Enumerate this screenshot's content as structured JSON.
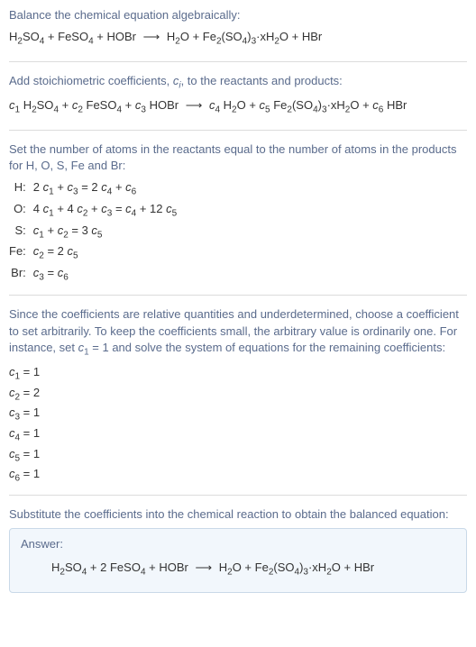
{
  "section1": {
    "intro": "Balance the chemical equation algebraically:",
    "eq_lhs1": "H",
    "eq_lhs1_sub": "2",
    "eq_lhs2": "SO",
    "eq_lhs2_sub": "4",
    "plus": " + ",
    "feso": "FeSO",
    "feso_sub": "4",
    "hobr": "HOBr",
    "arrow": "⟶",
    "h2o": "H",
    "h2o_sub": "2",
    "h2o_o": "O",
    "fe2": "Fe",
    "fe2_sub": "2",
    "so4": "(SO",
    "so4_sub1": "4",
    "so4_close": ")",
    "so4_sub2": "3",
    "hydrate": "·xH",
    "hydrate_sub": "2",
    "hydrate_o": "O",
    "hbr": "HBr"
  },
  "section2": {
    "intro_a": "Add stoichiometric coefficients, ",
    "ci": "c",
    "ci_sub": "i",
    "intro_b": ", to the reactants and products:",
    "c1": "c",
    "c1s": "1",
    "c2": "c",
    "c2s": "2",
    "c3": "c",
    "c3s": "3",
    "c4": "c",
    "c4s": "4",
    "c5": "c",
    "c5s": "5",
    "c6": "c",
    "c6s": "6"
  },
  "section3": {
    "intro": "Set the number of atoms in the reactants equal to the number of atoms in the products for H, O, S, Fe and Br:",
    "rows": {
      "H": {
        "label": "H:",
        "lhs_a": "2 ",
        "lhs_b": " + ",
        "rhs_a": " = 2 ",
        "rhs_b": " + "
      },
      "O": {
        "label": "O:",
        "lhs_a": "4 ",
        "lhs_b": " + 4 ",
        "lhs_c": " + ",
        "rhs_a": " = ",
        "rhs_b": " + 12 "
      },
      "S": {
        "label": "S:",
        "lhs_b": " + ",
        "rhs_a": " = 3 "
      },
      "Fe": {
        "label": "Fe:",
        "rhs_a": " = 2 "
      },
      "Br": {
        "label": "Br:",
        "rhs_a": " = "
      }
    }
  },
  "section4": {
    "intro": "Since the coefficients are relative quantities and underdetermined, choose a coefficient to set arbitrarily. To keep the coefficients small, the arbitrary value is ordinarily one. For instance, set ",
    "set": " = 1 and solve the system of equations for the remaining coefficients:",
    "vals": {
      "c1": " = 1",
      "c2": " = 2",
      "c3": " = 1",
      "c4": " = 1",
      "c5": " = 1",
      "c6": " = 1"
    }
  },
  "section5": {
    "intro": "Substitute the coefficients into the chemical reaction to obtain the balanced equation:"
  },
  "answer": {
    "label": "Answer:",
    "two": "2 "
  }
}
